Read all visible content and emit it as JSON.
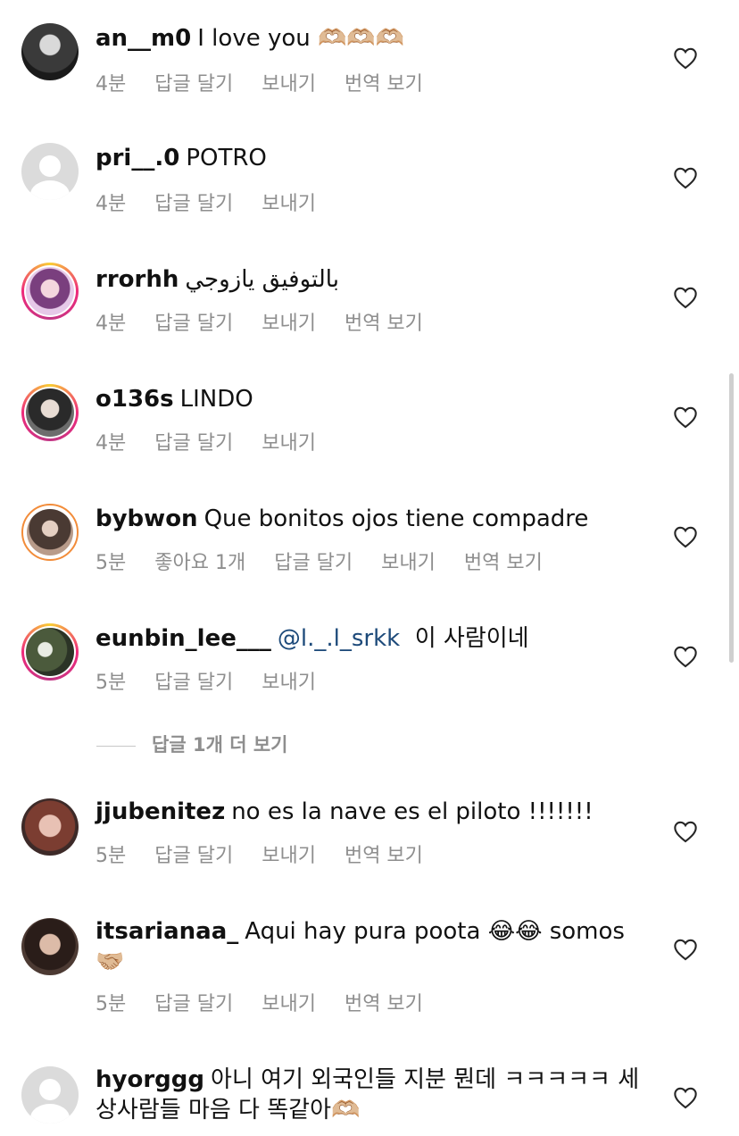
{
  "comments": [
    {
      "username": "an__m0",
      "text": "I love you 🫶🏼🫶🏼🫶🏼",
      "time": "4분",
      "likes": "",
      "reply": "답글 달기",
      "send": "보내기",
      "translate": "번역 보기",
      "avatar": "photo"
    },
    {
      "username": "pri__.0",
      "text": "POTRO",
      "time": "4분",
      "likes": "",
      "reply": "답글 달기",
      "send": "보내기",
      "translate": "",
      "avatar": "placeholder"
    },
    {
      "username": "rrorhh",
      "text": "بالتوفيق يازوجي",
      "time": "4분",
      "likes": "",
      "reply": "답글 달기",
      "send": "보내기",
      "translate": "번역 보기",
      "avatar": "photo-story"
    },
    {
      "username": "o136s",
      "text": "LINDO",
      "time": "4분",
      "likes": "",
      "reply": "답글 달기",
      "send": "보내기",
      "translate": "",
      "avatar": "photo-story"
    },
    {
      "username": "bybwon",
      "text": "Que bonitos ojos tiene compadre",
      "time": "5분",
      "likes": "좋아요 1개",
      "reply": "답글 달기",
      "send": "보내기",
      "translate": "번역 보기",
      "avatar": "photo-close"
    },
    {
      "username": "eunbin_lee___",
      "mention": "@l._.l_srkk",
      "text": "이 사람이네",
      "time": "5분",
      "likes": "",
      "reply": "답글 달기",
      "send": "보내기",
      "translate": "",
      "avatar": "photo-story"
    },
    {
      "username": "jjubenitez",
      "text": "no es la nave es el piloto !!!!!!!",
      "time": "5분",
      "likes": "",
      "reply": "답글 달기",
      "send": "보내기",
      "translate": "번역 보기",
      "avatar": "photo"
    },
    {
      "username": "itsarianaa_",
      "text": "Aqui hay pura poota 😂😂 somos 🤝🏼",
      "time": "5분",
      "likes": "",
      "reply": "답글 달기",
      "send": "보내기",
      "translate": "번역 보기",
      "avatar": "photo"
    },
    {
      "username": "hyorggg",
      "text": "아니 여기 외국인들 지분 뭔데 ㅋㅋㅋㅋㅋ 세상사람들 마음 다 똑같아🫶🏼",
      "time": "",
      "likes": "",
      "reply": "",
      "send": "",
      "translate": "",
      "avatar": "placeholder"
    }
  ],
  "more_replies": "답글 1개 더 보기",
  "icons": {
    "like": "heart-outline-icon"
  },
  "colors": {
    "meta": "#8e8e8e",
    "mention": "#1d4a7a",
    "story_ring": "#ee2a7b"
  }
}
